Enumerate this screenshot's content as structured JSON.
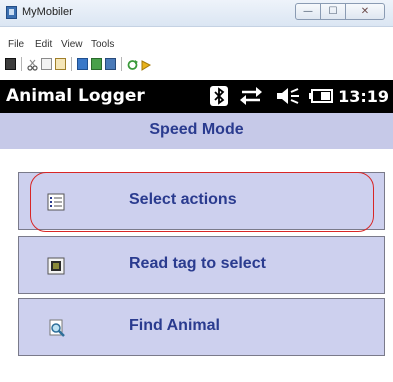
{
  "window": {
    "title": "MyMobiler",
    "minimize_glyph": "—",
    "maximize_glyph": "☐",
    "close_glyph": "✕"
  },
  "menu": {
    "file": "File",
    "edit": "Edit",
    "view": "View",
    "tools": "Tools"
  },
  "toolbar_icons": [
    "device-icon",
    "cut-icon",
    "copy-icon",
    "paste-icon",
    "copy-to-device-icon",
    "copy-from-device-icon",
    "screenshot-icon",
    "refresh-icon",
    "pin-icon"
  ],
  "status": {
    "app_title": "Animal Logger",
    "time": "13:19",
    "icons": [
      "bluetooth-icon",
      "connectivity-icon",
      "volume-icon",
      "battery-icon"
    ]
  },
  "header": {
    "title": "Speed Mode"
  },
  "actions": [
    {
      "label": "Select actions",
      "icon": "list-icon"
    },
    {
      "label": "Read tag to select",
      "icon": "rfid-tag-icon"
    },
    {
      "label": "Find Animal",
      "icon": "search-document-icon"
    }
  ],
  "colors": {
    "panel": "#cdd0ee",
    "header": "#c6c9e8",
    "text_accent": "#2a3b8f",
    "highlight": "#d82626",
    "statusbar": "#000000"
  }
}
